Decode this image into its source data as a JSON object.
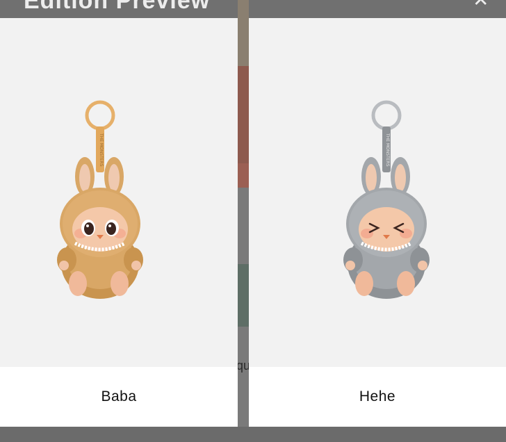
{
  "background": {
    "header_title": "Edition Preview",
    "close_glyph": "✕",
    "peek_text": "qu"
  },
  "products": [
    {
      "name": "Baba",
      "fur_color": "#d9a766",
      "fur_shadow": "#b9844a",
      "ring_color": "#e6b06a",
      "strap_color": "#e2a85c",
      "icon": "plush-keychain-icon"
    },
    {
      "name": "Hehe",
      "fur_color": "#a3a7ab",
      "fur_shadow": "#7f8388",
      "ring_color": "#b9bcc0",
      "strap_color": "#8f9397",
      "icon": "plush-keychain-icon"
    }
  ]
}
